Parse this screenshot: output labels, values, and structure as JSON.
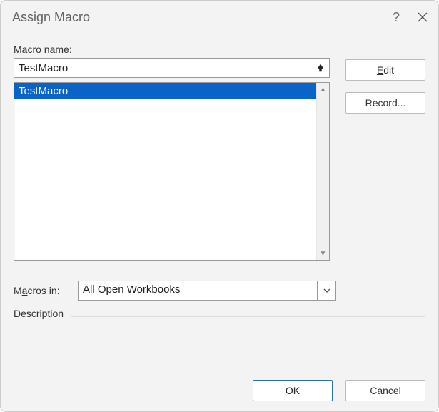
{
  "dialog": {
    "title": "Assign Macro"
  },
  "labels": {
    "macro_name_pre": "M",
    "macro_name_rest": "acro name:",
    "macros_in_pre": "M",
    "macros_in_mid": "a",
    "macros_in_rest": "cros in:",
    "description": "Description"
  },
  "fields": {
    "macro_name_value": "TestMacro",
    "macros_in_value": "All Open Workbooks"
  },
  "list": {
    "items": [
      "TestMacro"
    ],
    "selected_index": 0
  },
  "buttons": {
    "edit_pre": "E",
    "edit_rest": "dit",
    "record": "Record...",
    "ok": "OK",
    "cancel": "Cancel"
  }
}
